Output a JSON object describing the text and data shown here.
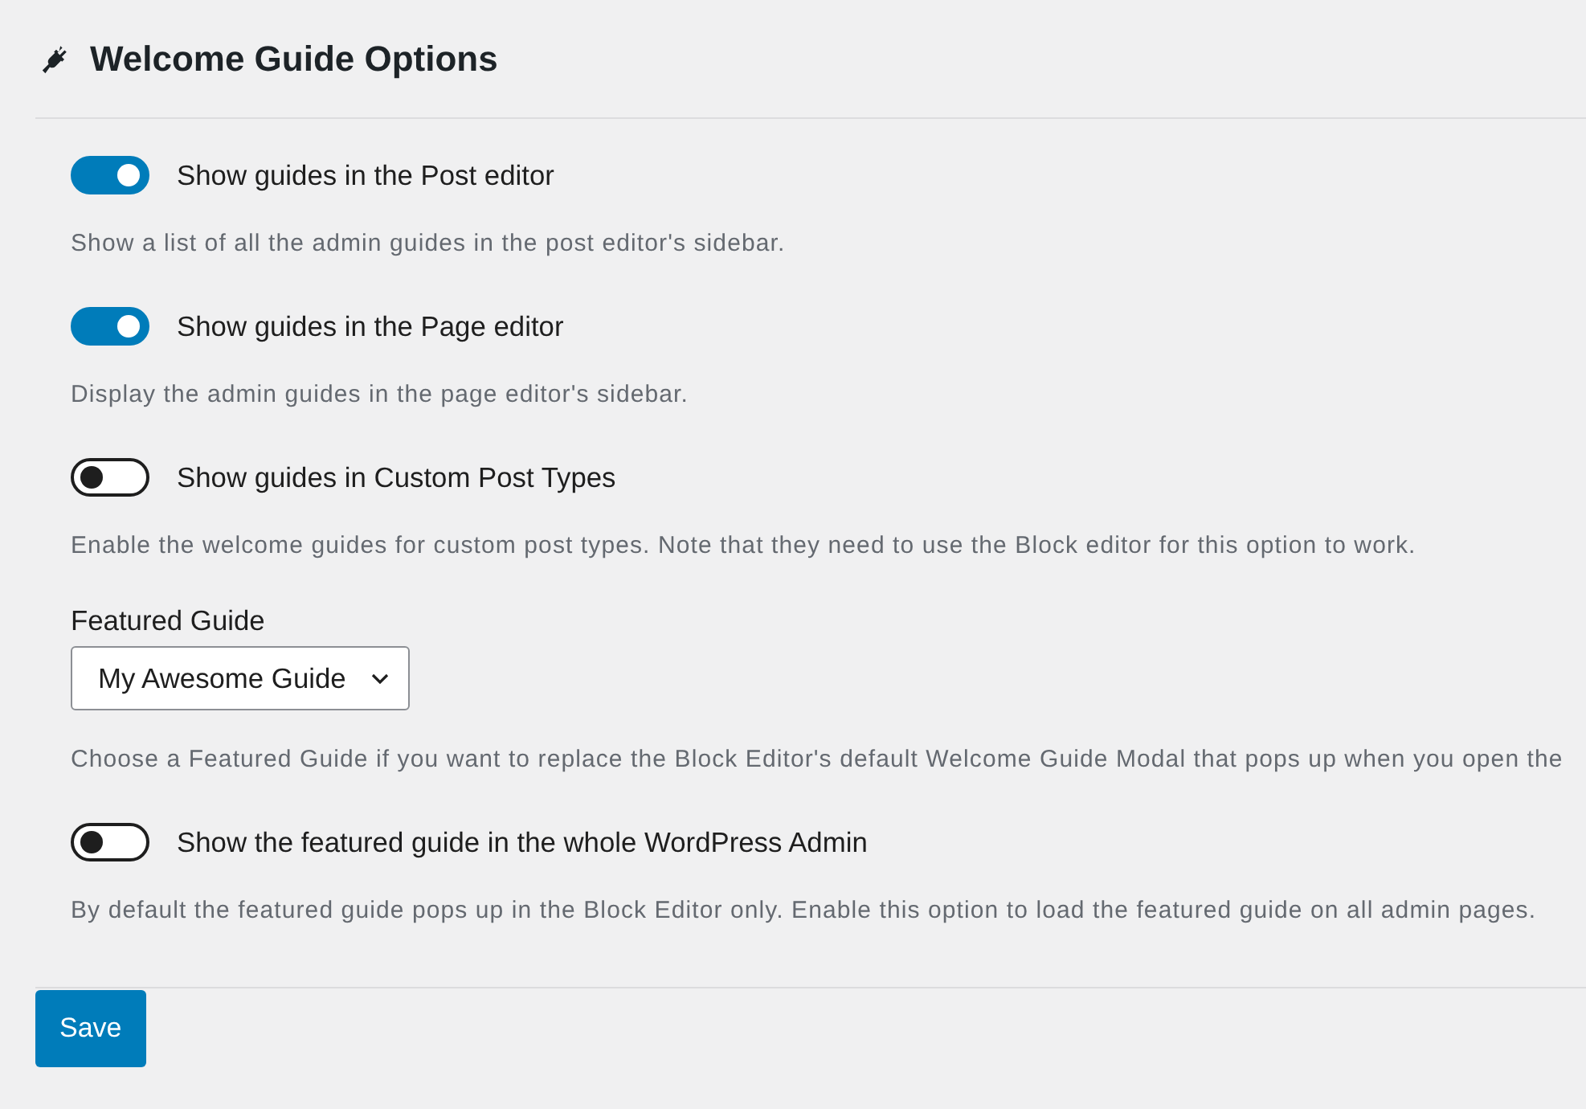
{
  "header": {
    "title": "Welcome Guide Options"
  },
  "settings": [
    {
      "kind": "toggle",
      "label": "Show guides in the Post editor",
      "on": true,
      "description": "Show a list of all the admin guides in the post editor's sidebar."
    },
    {
      "kind": "toggle",
      "label": "Show guides in the Page editor",
      "on": true,
      "description": "Display the admin guides in the page editor's sidebar."
    },
    {
      "kind": "toggle",
      "label": "Show guides in Custom Post Types",
      "on": false,
      "description": "Enable the welcome guides for custom post types. Note that they need to use the Block editor for this option to work."
    },
    {
      "kind": "select",
      "label": "Featured Guide",
      "value": "My Awesome Guide",
      "description": "Choose a Featured Guide if you want to replace the Block Editor's default Welcome Guide Modal that pops up when you open the"
    },
    {
      "kind": "toggle",
      "label": "Show the featured guide in the whole WordPress Admin",
      "on": false,
      "description": "By default the featured guide pops up in the Block Editor only. Enable this option to load the featured guide on all admin pages."
    }
  ],
  "save_button": {
    "label": "Save"
  }
}
